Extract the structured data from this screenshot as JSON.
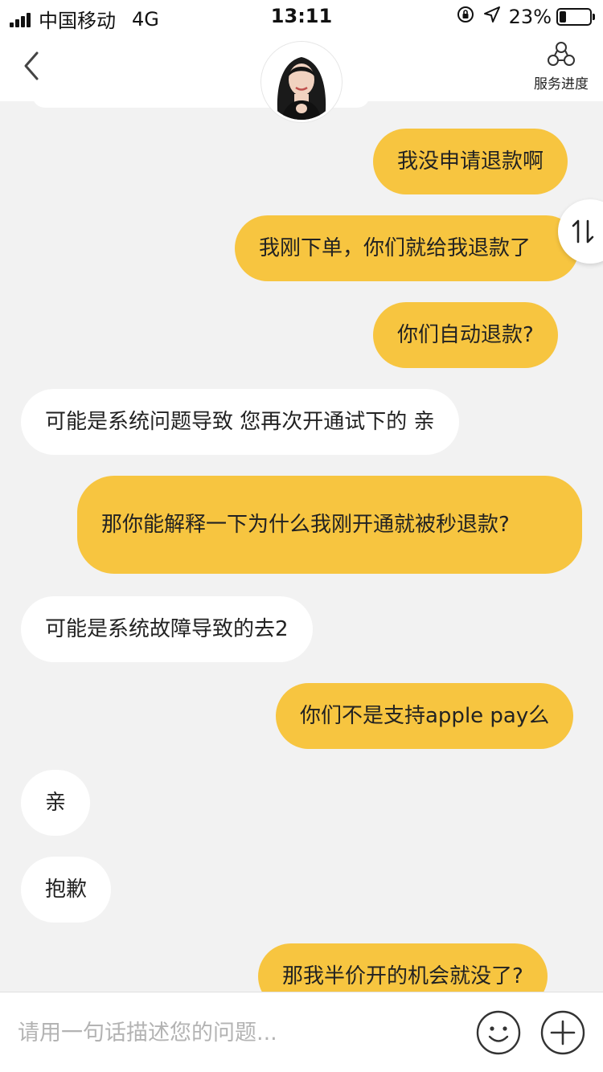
{
  "status_bar": {
    "carrier": "中国移动",
    "network": "4G",
    "time": "13:11",
    "battery_text": "23%",
    "battery_level": 0.23,
    "icons": [
      "signal-icon",
      "rotation-lock-icon",
      "location-arrow-icon",
      "battery-icon"
    ]
  },
  "nav": {
    "back_icon": "chevron-left-icon",
    "avatar": "agent-avatar",
    "service_label": "服务进度",
    "service_icon": "network-nodes-icon"
  },
  "messages": [
    {
      "side": "mine",
      "text": "我没申请退款啊"
    },
    {
      "side": "mine",
      "text": "我刚下单，你们就给我退款了"
    },
    {
      "side": "mine",
      "text": "你们自动退款?"
    },
    {
      "side": "theirs",
      "text": "可能是系统问题导致 您再次开通试下的 亲"
    },
    {
      "side": "mine",
      "text": "那你能解释一下为什么我刚开通就被秒退款?"
    },
    {
      "side": "theirs",
      "text": "可能是系统故障导致的去2"
    },
    {
      "side": "mine",
      "text": "你们不是支持apple pay么"
    },
    {
      "side": "theirs",
      "text": "亲"
    },
    {
      "side": "theirs",
      "text": "抱歉"
    },
    {
      "side": "mine",
      "text": "那我半价开的机会就没了?"
    }
  ],
  "sort_button": {
    "icon": "sort-arrows-icon"
  },
  "input_bar": {
    "placeholder": "请用一句话描述您的问题...",
    "value": "",
    "emoji_icon": "smiley-icon",
    "plus_icon": "plus-circle-icon"
  },
  "colors": {
    "mine_bubble": "#f7c540",
    "theirs_bubble": "#ffffff",
    "background": "#f2f2f2"
  }
}
